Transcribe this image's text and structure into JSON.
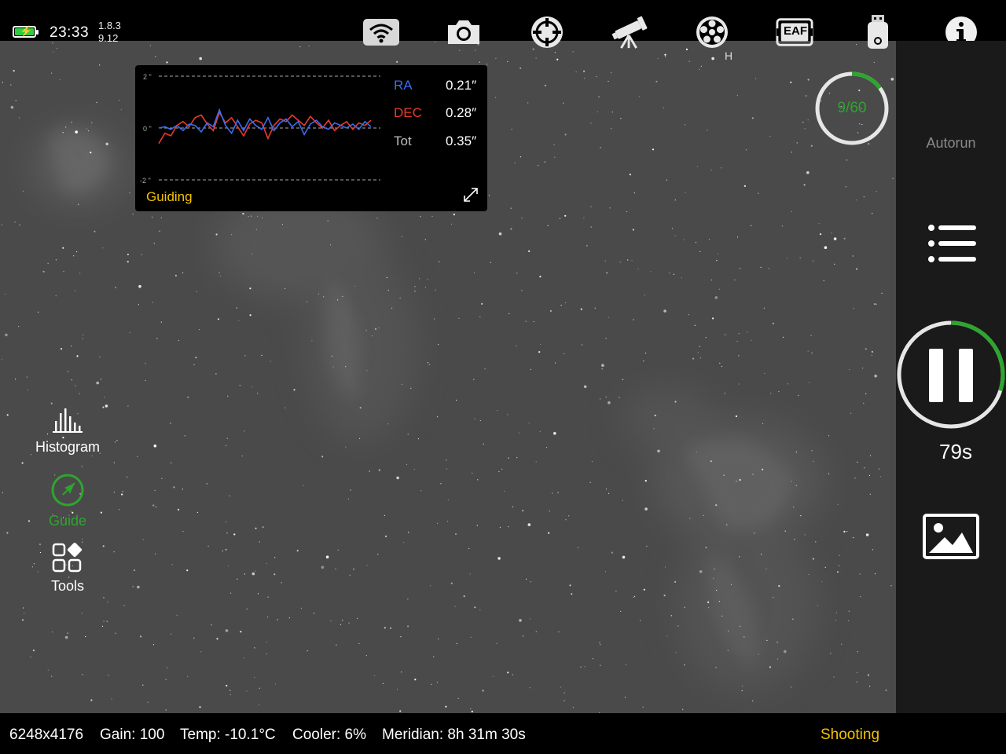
{
  "status": {
    "time": "23:33",
    "version_app": "1.8.3",
    "version_fw": "9.12",
    "battery_color": "#2ecc40"
  },
  "toolbar": {
    "icons": [
      "wifi-icon",
      "camera-icon",
      "focuser-target-icon",
      "telescope-icon",
      "filter-wheel-icon",
      "eaf-icon",
      "usb-storage-icon",
      "info-icon"
    ],
    "eaf_label": "EAF",
    "filter_label": "H"
  },
  "guiding": {
    "title": "Guiding",
    "title_color": "#f2c200",
    "scale_top": "2 \"",
    "scale_mid": "0 \"",
    "scale_bottom": "-2 \"",
    "ra_label": "RA",
    "ra_value": "0.21″",
    "ra_color": "#3a6df0",
    "dec_label": "DEC",
    "dec_value": "0.28″",
    "dec_color": "#e83a2e",
    "tot_label": "Tot",
    "tot_value": "0.35″",
    "ra_series": [
      0.0,
      0.05,
      -0.05,
      0.1,
      -0.1,
      0.15,
      0.1,
      -0.15,
      0.2,
      0.05,
      0.7,
      0.1,
      -0.2,
      0.3,
      -0.1,
      0.35,
      0.1,
      -0.05,
      0.4,
      -0.1,
      0.2,
      0.35,
      0.05,
      0.25,
      -0.25,
      0.15,
      0.3,
      0.05,
      -0.05,
      0.2,
      0.1,
      0.0,
      0.15,
      -0.05,
      0.25,
      0.05
    ],
    "dec_series": [
      -0.6,
      -0.2,
      -0.3,
      0.1,
      0.25,
      0.05,
      0.4,
      0.5,
      0.15,
      -0.1,
      0.6,
      0.2,
      0.4,
      0.05,
      -0.3,
      0.15,
      0.3,
      0.2,
      -0.4,
      0.1,
      0.35,
      0.25,
      0.5,
      0.3,
      0.1,
      0.45,
      0.2,
      0.0,
      0.3,
      -0.1,
      0.1,
      0.25,
      -0.05,
      0.2,
      0.1,
      0.3
    ]
  },
  "sidebar": {
    "histogram_label": "Histogram",
    "guide_label": "Guide",
    "guide_color": "#2ea52e",
    "tools_label": "Tools"
  },
  "sequence": {
    "counter": "9/60",
    "progress_fraction": 0.15,
    "autorun_label": "Autorun",
    "exposure_remaining": "79s",
    "exposure_progress_fraction": 0.3,
    "accent_color": "#2ea52e"
  },
  "footer": {
    "resolution": "6248x4176",
    "gain": "Gain: 100",
    "temp": "Temp: -10.1°C",
    "cooler": "Cooler: 6%",
    "meridian": "Meridian: 8h 31m 30s",
    "state": "Shooting",
    "state_color": "#f2c200"
  }
}
